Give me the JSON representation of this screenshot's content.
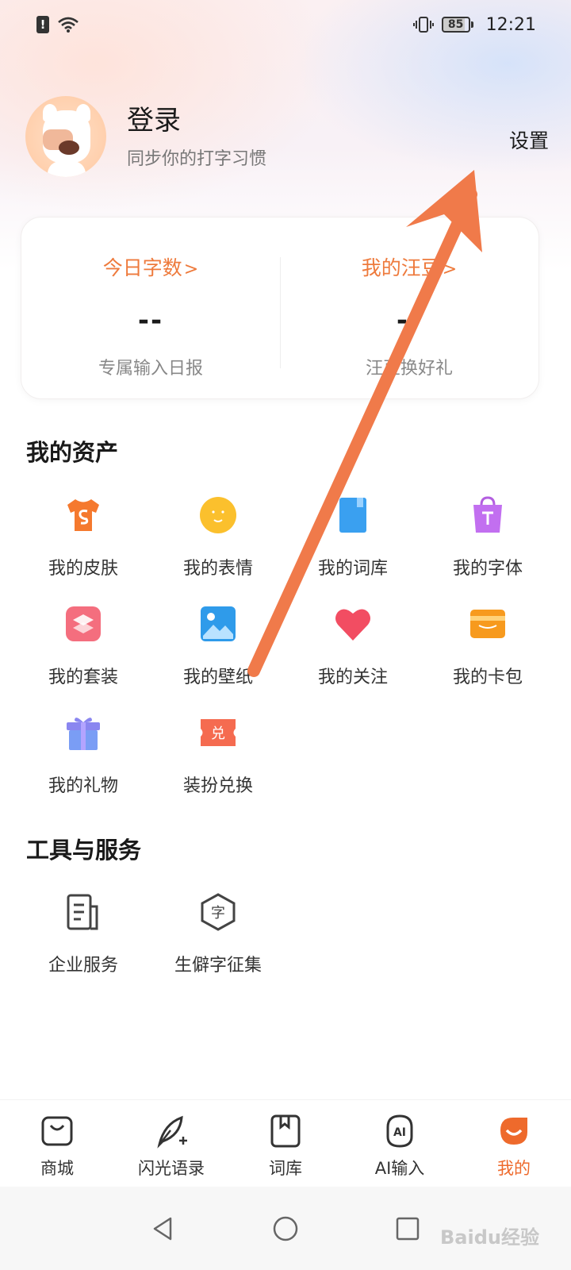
{
  "status_bar": {
    "time": "12:21",
    "battery": "85"
  },
  "profile": {
    "title": "登录",
    "subtitle": "同步你的打字习惯",
    "settings_label": "设置"
  },
  "stats": [
    {
      "title": "今日字数",
      "value": "--",
      "sub": "专属输入日报"
    },
    {
      "title": "我的汪豆",
      "value": "--",
      "sub": "汪豆换好礼"
    }
  ],
  "assets": {
    "title": "我的资产",
    "items": [
      {
        "label": "我的皮肤",
        "icon": "tshirt-icon"
      },
      {
        "label": "我的表情",
        "icon": "smiley-icon"
      },
      {
        "label": "我的词库",
        "icon": "book-icon"
      },
      {
        "label": "我的字体",
        "icon": "font-bag-icon"
      },
      {
        "label": "我的套装",
        "icon": "layers-icon"
      },
      {
        "label": "我的壁纸",
        "icon": "picture-icon"
      },
      {
        "label": "我的关注",
        "icon": "heart-icon"
      },
      {
        "label": "我的卡包",
        "icon": "card-icon"
      },
      {
        "label": "我的礼物",
        "icon": "gift-icon"
      },
      {
        "label": "装扮兑换",
        "icon": "redeem-icon"
      }
    ]
  },
  "tools": {
    "title": "工具与服务",
    "items": [
      {
        "label": "企业服务",
        "icon": "document-icon"
      },
      {
        "label": "生僻字征集",
        "icon": "character-icon"
      }
    ]
  },
  "tabbar": [
    {
      "label": "商城",
      "icon": "shop-bag-icon"
    },
    {
      "label": "闪光语录",
      "icon": "feather-icon"
    },
    {
      "label": "词库",
      "icon": "dictionary-icon"
    },
    {
      "label": "AI输入",
      "icon": "ai-icon"
    },
    {
      "label": "我的",
      "icon": "profile-icon",
      "active": true
    }
  ],
  "watermark": "Baidu经验",
  "colors": {
    "accent": "#ee7a3c",
    "arrow": "#f07a4a",
    "active_tab": "#ee6a2c"
  }
}
